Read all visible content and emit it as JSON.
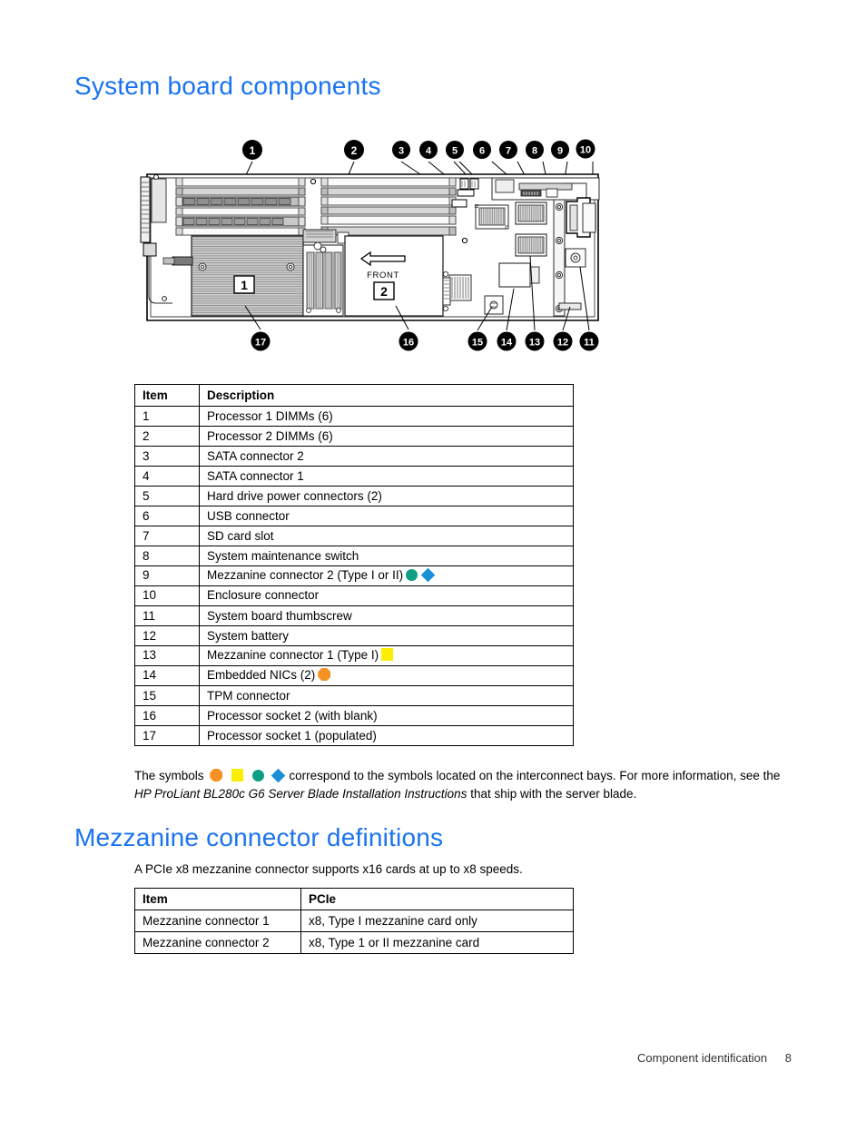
{
  "page": {
    "title": "System board components",
    "footer_section": "Component identification",
    "footer_page": "8"
  },
  "colors": {
    "heading_blue": "#1a73f0",
    "symbol_orange": "#f59123",
    "symbol_yellow": "#fcee00",
    "symbol_teal": "#0d9e84",
    "symbol_blue": "#1b8fd6"
  },
  "diagram": {
    "name": "system-board-top-view",
    "front_label": "FRONT",
    "processor_socket_1_label": "1",
    "processor_socket_2_label": "2",
    "callouts_top": [
      "1",
      "2",
      "3",
      "4",
      "5",
      "6",
      "7",
      "8",
      "9",
      "10"
    ],
    "callouts_bottom": [
      "17",
      "16",
      "15",
      "14",
      "13",
      "12",
      "11"
    ]
  },
  "components_table": {
    "headers": [
      "Item",
      "Description"
    ],
    "rows": [
      {
        "item": "1",
        "description": "Processor 1 DIMMs (6)",
        "symbols": []
      },
      {
        "item": "2",
        "description": "Processor 2 DIMMs (6)",
        "symbols": []
      },
      {
        "item": "3",
        "description": "SATA connector 2",
        "symbols": []
      },
      {
        "item": "4",
        "description": "SATA connector 1",
        "symbols": []
      },
      {
        "item": "5",
        "description": "Hard drive power connectors (2)",
        "symbols": []
      },
      {
        "item": "6",
        "description": "USB connector",
        "symbols": []
      },
      {
        "item": "7",
        "description": "SD card slot",
        "symbols": []
      },
      {
        "item": "8",
        "description": "System maintenance switch",
        "symbols": []
      },
      {
        "item": "9",
        "description": "Mezzanine connector 2 (Type I or II)",
        "symbols": [
          "teal-circle",
          "blue-diamond"
        ]
      },
      {
        "item": "10",
        "description": "Enclosure connector",
        "symbols": []
      },
      {
        "item": "11",
        "description": "System board thumbscrew",
        "symbols": []
      },
      {
        "item": "12",
        "description": "System battery",
        "symbols": []
      },
      {
        "item": "13",
        "description": "Mezzanine connector 1 (Type I)",
        "symbols": [
          "yellow-square"
        ]
      },
      {
        "item": "14",
        "description": "Embedded NICs (2)",
        "symbols": [
          "orange-octagon"
        ]
      },
      {
        "item": "15",
        "description": "TPM connector",
        "symbols": []
      },
      {
        "item": "16",
        "description": "Processor socket 2 (with blank)",
        "symbols": []
      },
      {
        "item": "17",
        "description": "Processor socket 1 (populated)",
        "symbols": []
      }
    ]
  },
  "footnote": {
    "lead": "The symbols",
    "symbols": [
      "orange-octagon",
      "yellow-square",
      "teal-circle",
      "blue-diamond"
    ],
    "middle": "correspond to the symbols located on the interconnect bays. For more information, see the",
    "doc_title_italic": "HP ProLiant BL280c G6 Server Blade Installation Instructions",
    "tail": "that ship with the server blade."
  },
  "mezzanine_section": {
    "title": "Mezzanine connector definitions",
    "intro": "A PCIe x8 mezzanine connector supports x16 cards at up to x8 speeds.",
    "table": {
      "headers": [
        "Item",
        "PCIe"
      ],
      "rows": [
        {
          "item": "Mezzanine connector 1",
          "pcie": "x8, Type I mezzanine card only"
        },
        {
          "item": "Mezzanine connector 2",
          "pcie": "x8, Type 1 or II mezzanine card"
        }
      ]
    }
  }
}
